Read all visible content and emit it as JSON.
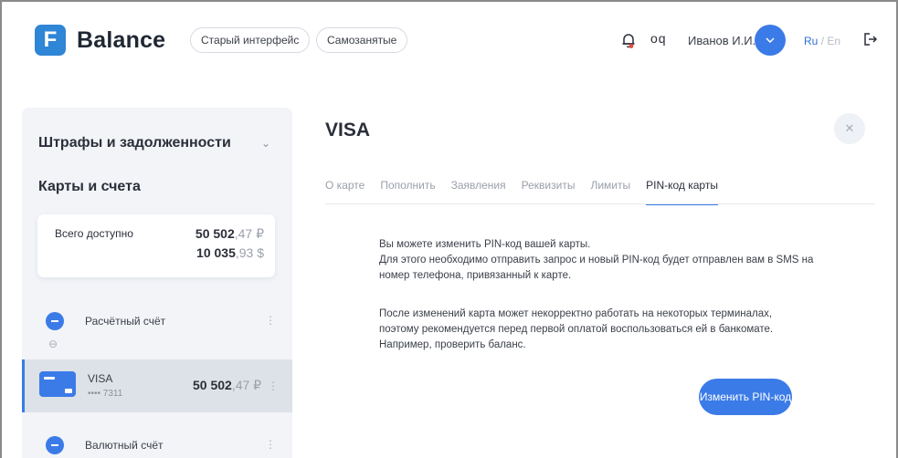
{
  "header": {
    "logo_mark": "F",
    "logo_text": "Balance",
    "old_ui_label": "Старый интерфейс",
    "selfemployed_label": "Самозанятые",
    "oq_label": "oq",
    "username": "Иванов И.И.",
    "user_btn_icon": "chevron-down",
    "lang_ru": "Ru",
    "lang_sep": "/",
    "lang_en": "En"
  },
  "sidebar": {
    "fines_title": "Штрафы и задолженности",
    "fines_chevron": "⌄",
    "cards_title": "Карты и счета",
    "total": {
      "label": "Всего доступно",
      "rub_int": "50 502",
      "rub_frac": ",47 ₽",
      "usd_int": "10 035",
      "usd_frac": ",93 $"
    },
    "accounts": [
      {
        "name": "Расчётный счёт"
      },
      {
        "name": "Валютный счёт"
      }
    ],
    "visa": {
      "name": "VISA",
      "number": "•••• 7311",
      "amount_int": "50 502",
      "amount_frac": ",47 ₽"
    }
  },
  "main": {
    "title": "VISA",
    "tabs": [
      {
        "label": "О карте"
      },
      {
        "label": "Пополнить"
      },
      {
        "label": "Заявления"
      },
      {
        "label": "Реквизиты"
      },
      {
        "label": "Лимиты"
      },
      {
        "label": "PIN-код карты"
      }
    ],
    "active_tab": "PIN-код карты",
    "paragraph1": [
      "Вы можете изменить PIN-код вашей карты.",
      "Для этого необходимо отправить запрос и новый PIN-код будет отправлен вам в SMS на",
      "номер телефона, привязанный к карте."
    ],
    "paragraph2": [
      "После изменений карта может некорректно работать на некоторых терминалах,",
      "поэтому рекомендуется перед первой оплатой воспользоваться ей в банкомате.",
      "Например, проверить баланс."
    ],
    "change_pin_button": "Изменить PIN-код"
  },
  "colors": {
    "accent": "#3b7be8",
    "logo": "#2f85d6",
    "sidebar_bg": "#f2f4f8",
    "selected_row": "#dde1e8"
  }
}
